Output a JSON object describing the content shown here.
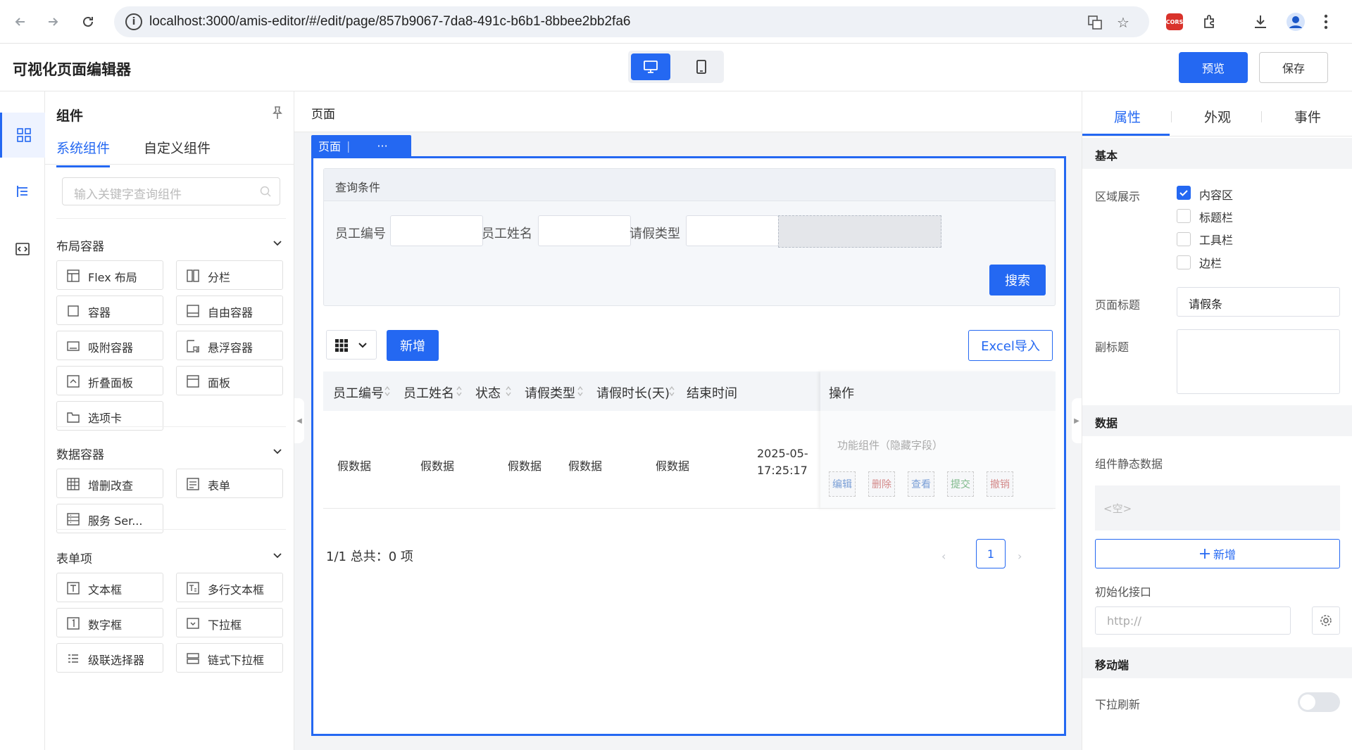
{
  "browser": {
    "url": "localhost:3000/amis-editor/#/edit/page/857b9067-7da8-491c-b6b1-8bbee2bb2fa6",
    "cors_label": "CORS"
  },
  "header": {
    "title": "可视化页面编辑器",
    "preview_label": "预览",
    "save_label": "保存"
  },
  "components_panel": {
    "title": "组件",
    "tabs": [
      "系统组件",
      "自定义组件"
    ],
    "search_placeholder": "输入关键字查询组件",
    "groups": [
      {
        "name": "布局容器",
        "items": [
          "Flex 布局",
          "分栏",
          "容器",
          "自由容器",
          "吸附容器",
          "悬浮容器",
          "折叠面板",
          "面板",
          "选项卡"
        ]
      },
      {
        "name": "数据容器",
        "items": [
          "增删改查",
          "表单",
          "服务 Ser..."
        ]
      },
      {
        "name": "表单项",
        "items": [
          "文本框",
          "多行文本框",
          "数字框",
          "下拉框",
          "级联选择器",
          "链式下拉框"
        ]
      }
    ]
  },
  "canvas": {
    "breadcrumb": "页面",
    "page_tag": "页面",
    "page_tag_more": "···",
    "query": {
      "title": "查询条件",
      "fields": [
        "员工编号",
        "员工姓名",
        "请假类型"
      ],
      "search_label": "搜索"
    },
    "toolbar": {
      "add_label": "新增",
      "excel_label": "Excel导入"
    },
    "table": {
      "columns": [
        "员工编号",
        "员工姓名",
        "状态",
        "请假类型",
        "请假时长(天)",
        "结束时间",
        "操作"
      ],
      "row": [
        "假数据",
        "假数据",
        "假数据",
        "假数据",
        "假数据",
        "2025-05-",
        "17:25:17"
      ],
      "op_hint": "功能组件（隐藏字段）",
      "op_buttons": [
        "编辑",
        "删除",
        "查看",
        "提交",
        "撤销"
      ]
    },
    "pager": {
      "summary": "1/1 总共：0 项",
      "prev": "‹",
      "current": "1",
      "next": "›"
    }
  },
  "props_panel": {
    "tabs": [
      "属性",
      "外观",
      "事件"
    ],
    "sections": {
      "basic": "基本",
      "data": "数据",
      "mobile": "移动端"
    },
    "region_label": "区域展示",
    "regions": [
      {
        "label": "内容区",
        "checked": true
      },
      {
        "label": "标题栏",
        "checked": false
      },
      {
        "label": "工具栏",
        "checked": false
      },
      {
        "label": "边栏",
        "checked": false
      }
    ],
    "page_title_label": "页面标题",
    "page_title_value": "请假条",
    "subtitle_label": "副标题",
    "static_data_label": "组件静态数据",
    "static_data_empty": "<空>",
    "add_label": "新增",
    "init_api_label": "初始化接口",
    "init_api_placeholder": "http://",
    "pull_refresh_label": "下拉刷新",
    "pull_refresh_on": false
  },
  "colors": {
    "accent": "#2468f2"
  }
}
